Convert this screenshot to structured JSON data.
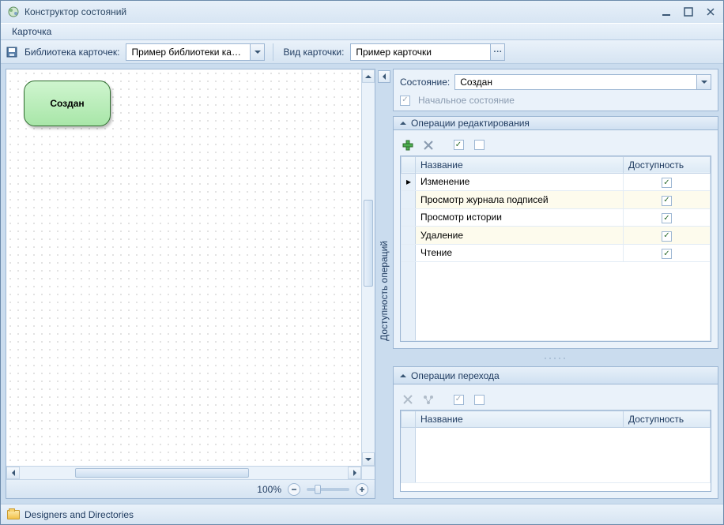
{
  "window": {
    "title": "Конструктор состояний"
  },
  "menu": {
    "card": "Карточка"
  },
  "toolbar": {
    "library_label": "Библиотека карточек:",
    "library_value": "Пример библиотеки карт...",
    "view_label": "Вид карточки:",
    "view_value": "Пример карточки"
  },
  "canvas": {
    "state_node": "Создан",
    "zoom": "100%"
  },
  "side_tab": "Доступность операций",
  "state_panel": {
    "label": "Состояние:",
    "value": "Создан",
    "initial_label": "Начальное состояние",
    "initial_checked": true
  },
  "edit_ops": {
    "header": "Операции редактирования",
    "columns": {
      "name": "Название",
      "avail": "Доступность"
    },
    "rows": [
      {
        "name": "Изменение",
        "avail": true
      },
      {
        "name": "Просмотр журнала подписей",
        "avail": true
      },
      {
        "name": "Просмотр истории",
        "avail": true
      },
      {
        "name": "Удаление",
        "avail": true
      },
      {
        "name": "Чтение",
        "avail": true
      }
    ]
  },
  "trans_ops": {
    "header": "Операции перехода",
    "columns": {
      "name": "Название",
      "avail": "Доступность"
    }
  },
  "statusbar": {
    "text": "Designers and Directories"
  }
}
